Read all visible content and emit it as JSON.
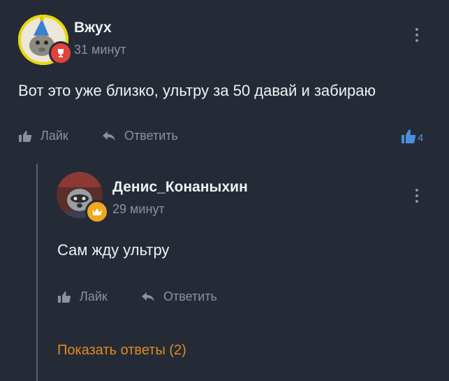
{
  "comment": {
    "author": "Вжух",
    "time": "31 минут",
    "text": "Вот это уже близко, ультру за 50 давай и забираю",
    "like_label": "Лайк",
    "reply_label": "Ответить",
    "likes_count": "4",
    "badge_icon": "trophy-icon",
    "badge_color": "#e0433b"
  },
  "reply": {
    "author": "Денис_Конаныхин",
    "time": "29 минут",
    "text": "Сам жду ультру",
    "like_label": "Лайк",
    "reply_label": "Ответить",
    "badge_icon": "crown-icon",
    "badge_color": "#f0a81e"
  },
  "show_replies_label": "Показать ответы (2)"
}
